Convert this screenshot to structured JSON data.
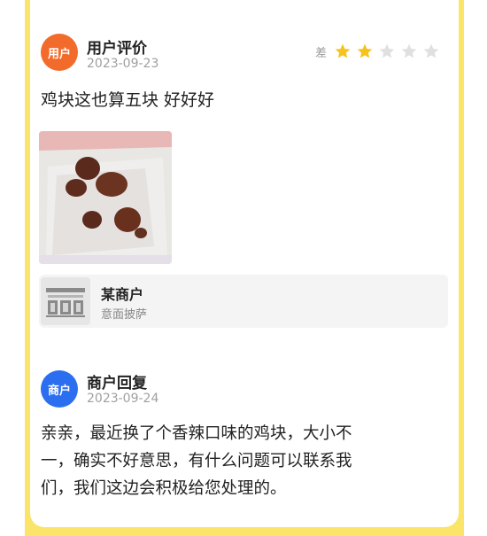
{
  "colors": {
    "frame": "#fbe46a",
    "user_avatar": "#f36b2b",
    "merchant_avatar": "#2b6ff0",
    "star_filled": "#f7c21c",
    "star_empty": "#e0e0e0"
  },
  "user_review": {
    "avatar_label": "用户",
    "name": "用户评价",
    "date": "2023-09-23",
    "rating_label": "差",
    "rating": 2,
    "rating_max": 5,
    "text": "鸡块这也算五块 好好好",
    "photo_icon": "food-photo"
  },
  "shop": {
    "icon": "storefront-icon",
    "name": "某商户",
    "subtitle": "意面披萨"
  },
  "merchant_reply": {
    "avatar_label": "商户",
    "name": "商户回复",
    "date": "2023-09-24",
    "lines": [
      "亲亲，最近换了个香辣口味的鸡块，大小不",
      "一，确实不好意思，有什么问题可以联系我",
      "们，我们这边会积极给您处理的。"
    ]
  }
}
